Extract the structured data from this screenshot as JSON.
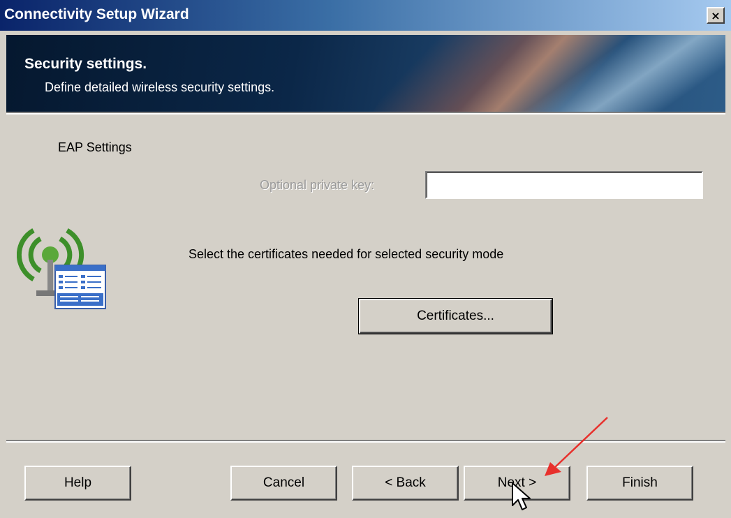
{
  "window": {
    "title": "Connectivity Setup Wizard",
    "close_label": "×"
  },
  "banner": {
    "title": "Security settings.",
    "subtitle": "Define detailed wireless security settings."
  },
  "section": {
    "title": "EAP Settings"
  },
  "private_key": {
    "label": "Optional private key:",
    "value": ""
  },
  "instructions": "Select the certificates needed for selected security mode",
  "buttons": {
    "certificates": "Certificates...",
    "help": "Help",
    "cancel": "Cancel",
    "back": "< Back",
    "next": "Next >",
    "finish": "Finish"
  },
  "colors": {
    "window_bg": "#d4d0c8",
    "titlebar_start": "#0a246a",
    "titlebar_end": "#a6caf0",
    "annotation_arrow": "#e8302c"
  },
  "icons": {
    "app_icon": "wireless-network-icon",
    "close": "close-icon",
    "cursor": "mouse-pointer-icon",
    "annotation": "red-arrow-annotation"
  }
}
